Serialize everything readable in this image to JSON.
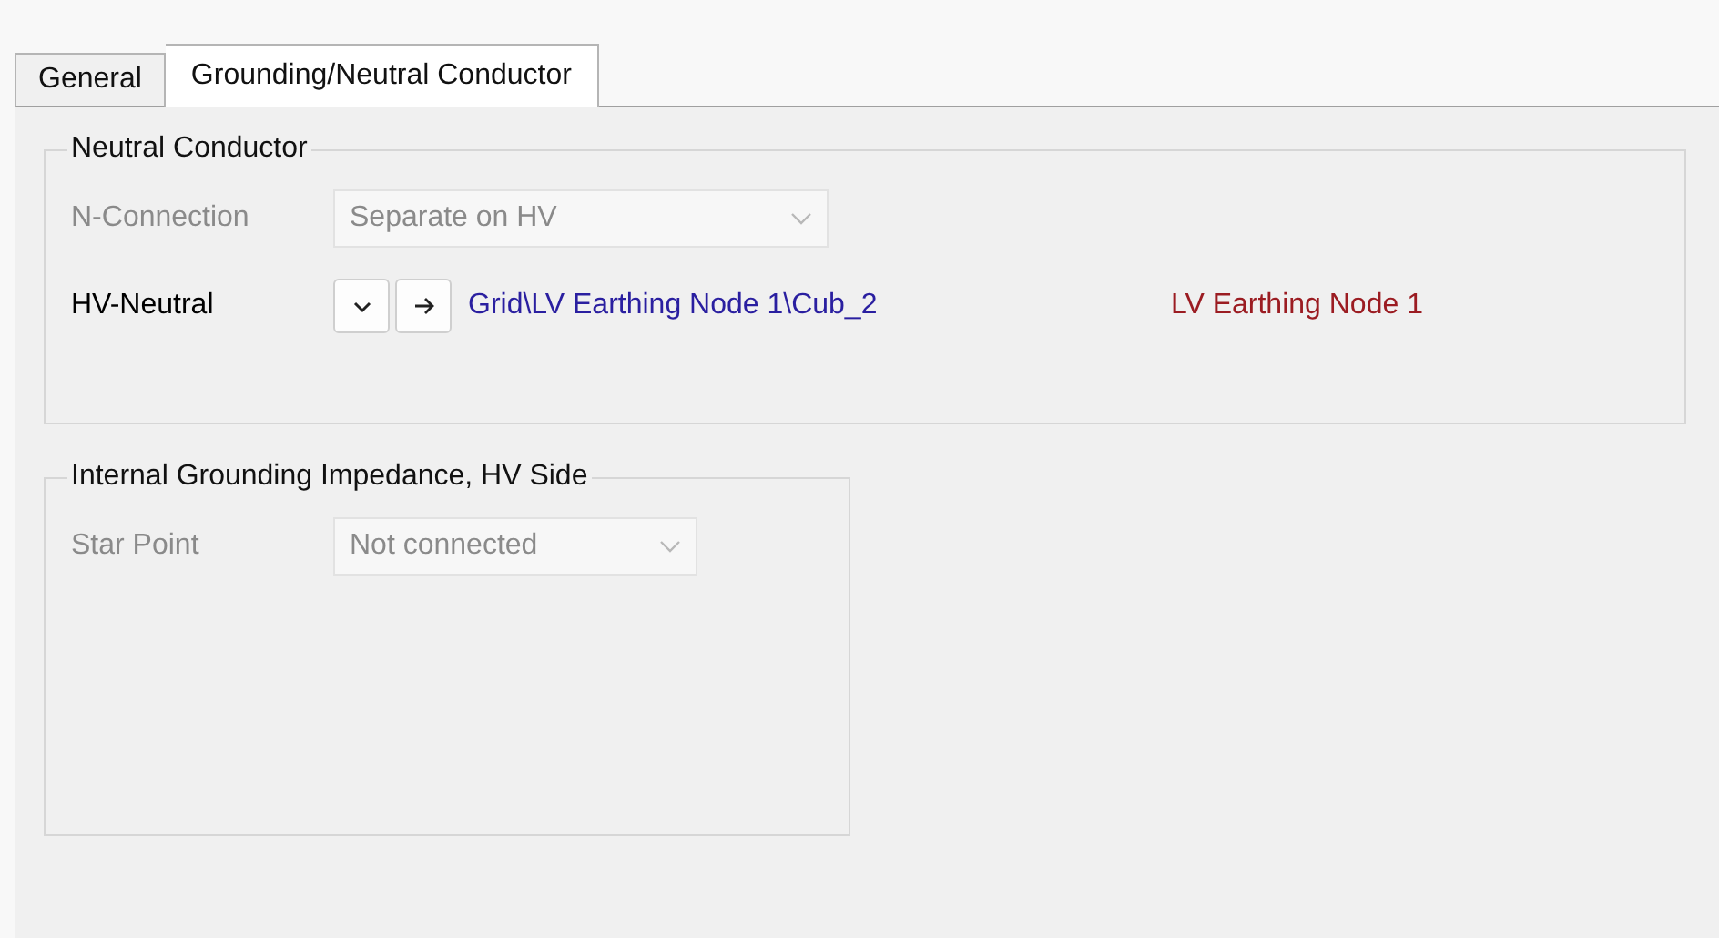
{
  "tabs": [
    {
      "label": "General",
      "selected": false
    },
    {
      "label": "Grounding/Neutral Conductor",
      "selected": true
    }
  ],
  "groups": [
    {
      "title": "Neutral Conductor",
      "rows": [
        {
          "kind": "dropdown",
          "label": "N-Connection",
          "value": "Separate on HV",
          "disabled": true
        },
        {
          "kind": "reference",
          "label": "HV-Neutral",
          "path": "Grid\\LV Earthing Node 1\\Cub_2",
          "target": "LV Earthing Node 1"
        }
      ]
    },
    {
      "title": "Internal Grounding Impedance, HV Side",
      "rows": [
        {
          "kind": "dropdown",
          "label": "Star Point",
          "value": "Not connected",
          "disabled": true
        }
      ]
    }
  ]
}
